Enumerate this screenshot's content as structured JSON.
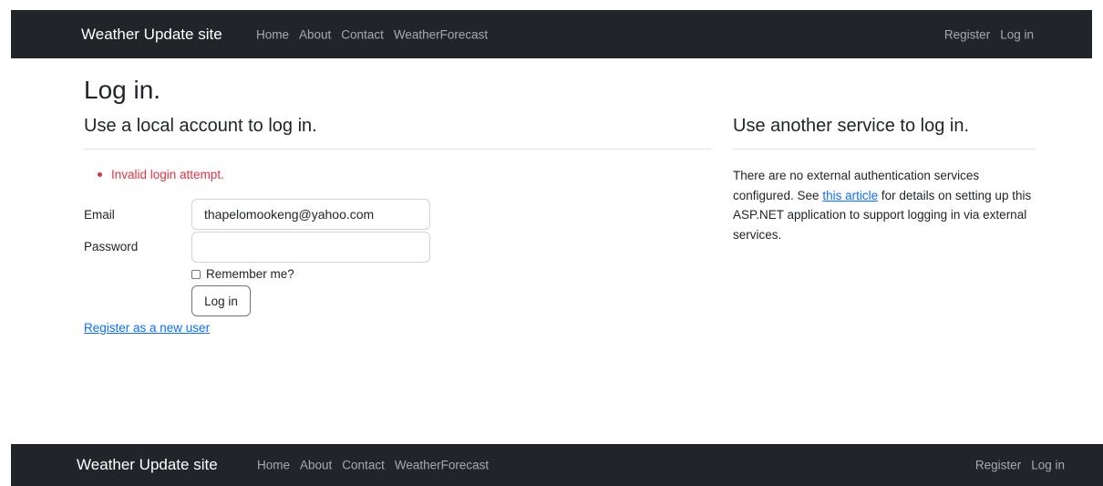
{
  "nav": {
    "brand": "Weather Update site",
    "links": [
      "Home",
      "About",
      "Contact",
      "WeatherForecast"
    ],
    "right": [
      "Register",
      "Log in"
    ]
  },
  "page": {
    "title": "Log in.",
    "local_heading": "Use a local account to log in.",
    "external_heading": "Use another service to log in."
  },
  "form": {
    "error": "Invalid login attempt.",
    "email_label": "Email",
    "email_value": "thapelomookeng@yahoo.com",
    "password_label": "Password",
    "password_value": "",
    "remember_label": "Remember me?",
    "remember_checked": false,
    "submit_label": "Log in",
    "register_link": "Register as a new user"
  },
  "external": {
    "text_before": "There are no external authentication services configured. See ",
    "link_text": "this article",
    "text_after": " for details on setting up this ASP.NET application to support logging in via external services."
  },
  "colors": {
    "navbar": "#212529",
    "error": "#dc3545",
    "link": "#0d6efd"
  }
}
